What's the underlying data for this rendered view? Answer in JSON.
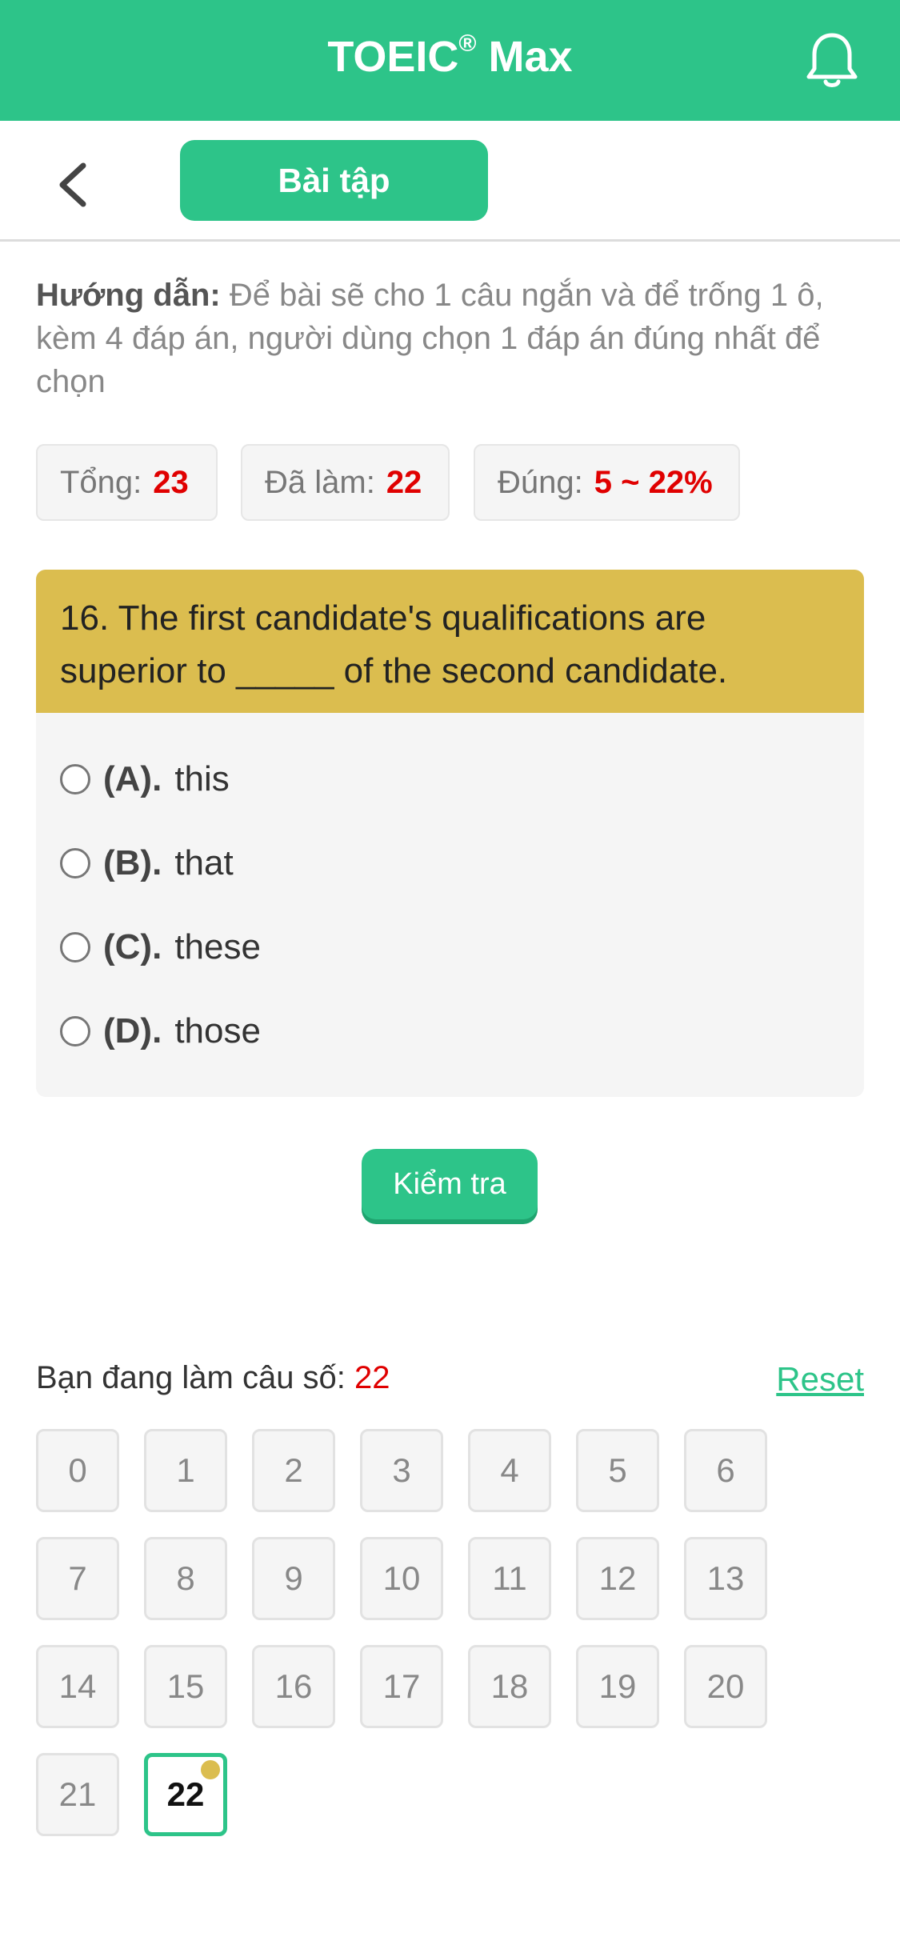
{
  "header": {
    "title": "TOEIC",
    "title_mark": "®",
    "title_suffix": " Max",
    "bell_icon": "bell-icon"
  },
  "nav": {
    "back_icon": "chevron-left-icon",
    "tab_label": "Bài tập"
  },
  "instructions": {
    "label": "Hướng dẫn:",
    "text": " Để bài sẽ cho 1 câu ngắn và để trống 1 ô, kèm 4 đáp án, người dùng chọn 1 đáp án đúng nhất để chọn"
  },
  "stats": {
    "total_label": "Tổng:",
    "total_value": "23",
    "done_label": "Đã làm:",
    "done_value": "22",
    "correct_label": "Đúng:",
    "correct_value": "5 ~ 22%"
  },
  "question": {
    "text": "16. The first candidate's qualifications are superior to _____ of the second candidate.",
    "options": [
      {
        "letter": "(A).",
        "text": "this"
      },
      {
        "letter": "(B).",
        "text": "that"
      },
      {
        "letter": "(C).",
        "text": "these"
      },
      {
        "letter": "(D).",
        "text": "those"
      }
    ]
  },
  "check_button": "Kiểm tra",
  "progress": {
    "label": "Bạn đang làm câu số:",
    "current": "22",
    "reset_label": "Reset",
    "items": [
      "0",
      "1",
      "2",
      "3",
      "4",
      "5",
      "6",
      "7",
      "8",
      "9",
      "10",
      "11",
      "12",
      "13",
      "14",
      "15",
      "16",
      "17",
      "18",
      "19",
      "20",
      "21",
      "22"
    ],
    "active_item": "22"
  },
  "colors": {
    "primary": "#2dc489",
    "accent": "#dbbd4f",
    "highlight": "#e00000"
  }
}
